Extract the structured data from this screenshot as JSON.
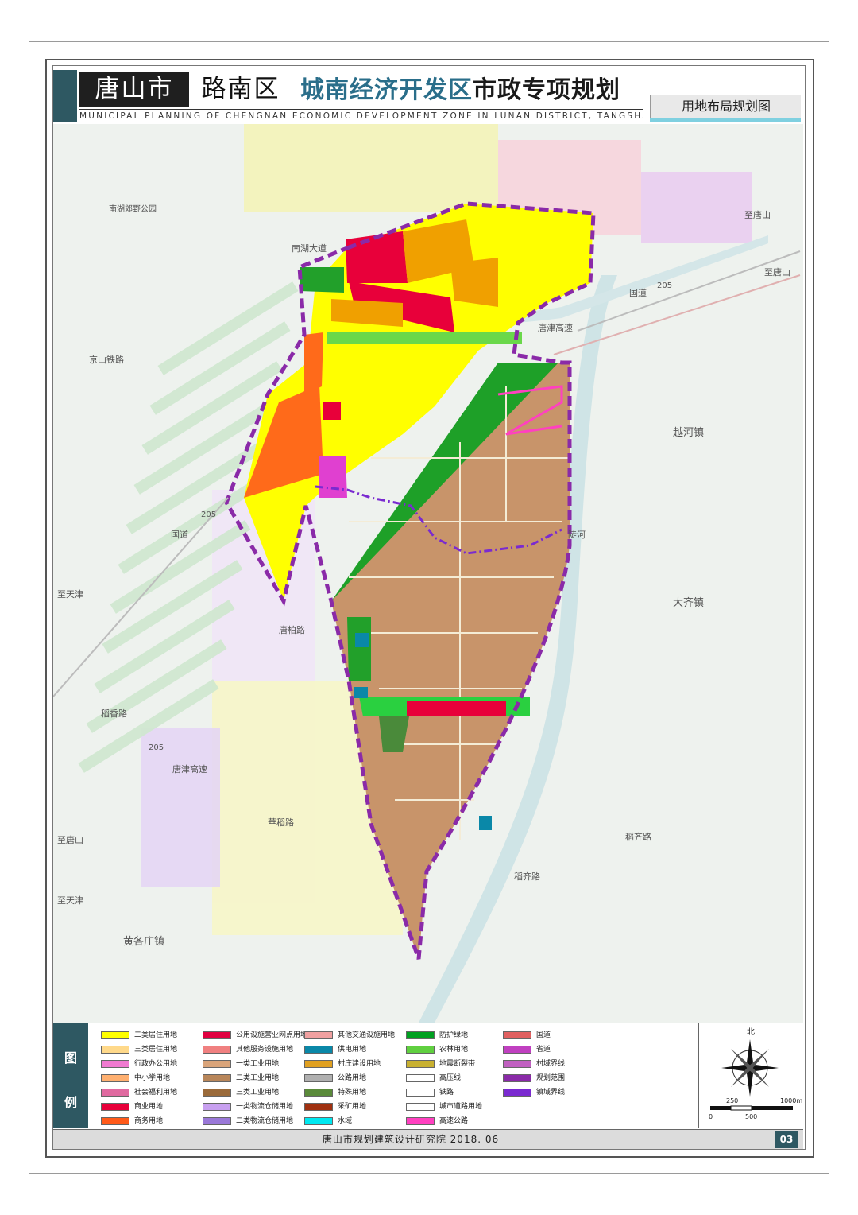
{
  "header": {
    "city": "唐山市",
    "district": "路南区",
    "title_part1": "城南经济开发区",
    "title_part2": "市政专项规划",
    "subtitle_en": "MUNICIPAL PLANNING OF CHENGNAN ECONOMIC DEVELOPMENT ZONE IN LUNAN DISTRICT, TANGSHAN CITY",
    "sheet_title": "用地布局规划图"
  },
  "map_labels": {
    "park": "南湖郊野公园",
    "road_nanhu": "南湖大道",
    "rail_jingshan": "京山铁路",
    "to_tangshan_1": "至唐山",
    "to_tangshan_2": "至唐山",
    "to_tangshan_3": "至唐山",
    "g205_1": "205",
    "g205_2": "205",
    "g205_3": "205",
    "guodao_1": "国道",
    "guodao_2": "国道",
    "tangjin_hw_1": "唐津高速",
    "tangjin_hw_2": "唐津高速",
    "to_tianjin_1": "至天津",
    "to_tianjin_2": "至天津",
    "yuehe_town": "越河镇",
    "daqi_town": "大齐镇",
    "huanggezhuang_town": "黄各庄镇",
    "douhe": "陡河",
    "tangbai_rd": "唐柏路",
    "daoxiang_rd": "稻香路",
    "huadao_rd": "華稻路",
    "daoqi_rd_1": "稻齐路",
    "daoqi_rd_2": "稻齐路"
  },
  "legend": {
    "title_top": "图",
    "title_bottom": "例",
    "items": [
      {
        "label": "二类居住用地",
        "color": "#ffff00"
      },
      {
        "label": "三类居住用地",
        "color": "#ffd98a"
      },
      {
        "label": "行政办公用地",
        "color": "#f07ad0"
      },
      {
        "label": "中小学用地",
        "color": "#ffb070"
      },
      {
        "label": "社会福利用地",
        "color": "#e06aa0"
      },
      {
        "label": "商业用地",
        "color": "#e8003a"
      },
      {
        "label": "商务用地",
        "color": "#ff5a1a"
      },
      {
        "label": "公用设施营业网点用地",
        "color": "#e00040"
      },
      {
        "label": "其他服务设施用地",
        "color": "#f08080"
      },
      {
        "label": "一类工业用地",
        "color": "#d9a47a"
      },
      {
        "label": "二类工业用地",
        "color": "#b8865a"
      },
      {
        "label": "三类工业用地",
        "color": "#9a6a3a"
      },
      {
        "label": "一类物流仓储用地",
        "color": "#c8a0f0"
      },
      {
        "label": "二类物流仓储用地",
        "color": "#9a78d8"
      },
      {
        "label": "其他交通设施用地",
        "color": "#f0a0a0"
      },
      {
        "label": "供电用地",
        "color": "#0a88a8"
      },
      {
        "label": "村庄建设用地",
        "color": "#e0a020"
      },
      {
        "label": "公路用地",
        "color": "#b0b0b0"
      },
      {
        "label": "特殊用地",
        "color": "#5a8a3a"
      },
      {
        "label": "采矿用地",
        "color": "#a03010"
      },
      {
        "label": "水域",
        "color": "#00e8f0"
      },
      {
        "label": "防护绿地",
        "color": "#00a020"
      },
      {
        "label": "农林用地",
        "color": "#60d040"
      },
      {
        "label": "地震断裂带",
        "color": "#c8b030"
      },
      {
        "label": "高压线",
        "color": "#ffffff"
      },
      {
        "label": "铁路",
        "color": "#ffffff"
      },
      {
        "label": "城市道路用地",
        "color": "#ffffff"
      },
      {
        "label": "高速公路",
        "color": "#ff40c0"
      },
      {
        "label": "国道",
        "color": "#e06060"
      },
      {
        "label": "省道",
        "color": "#c040c0"
      },
      {
        "label": "村域界线",
        "color": "#c060c0"
      },
      {
        "label": "规划范围",
        "color": "#8a2aa8"
      },
      {
        "label": "镇域界线",
        "color": "#7a2ad0"
      }
    ]
  },
  "compass": {
    "north": "北",
    "scale_0": "0",
    "scale_250": "250",
    "scale_500": "500",
    "scale_1000": "1000m"
  },
  "footer": {
    "institute": "唐山市规划建筑设计研究院  2018. 06",
    "page_number": "03"
  }
}
